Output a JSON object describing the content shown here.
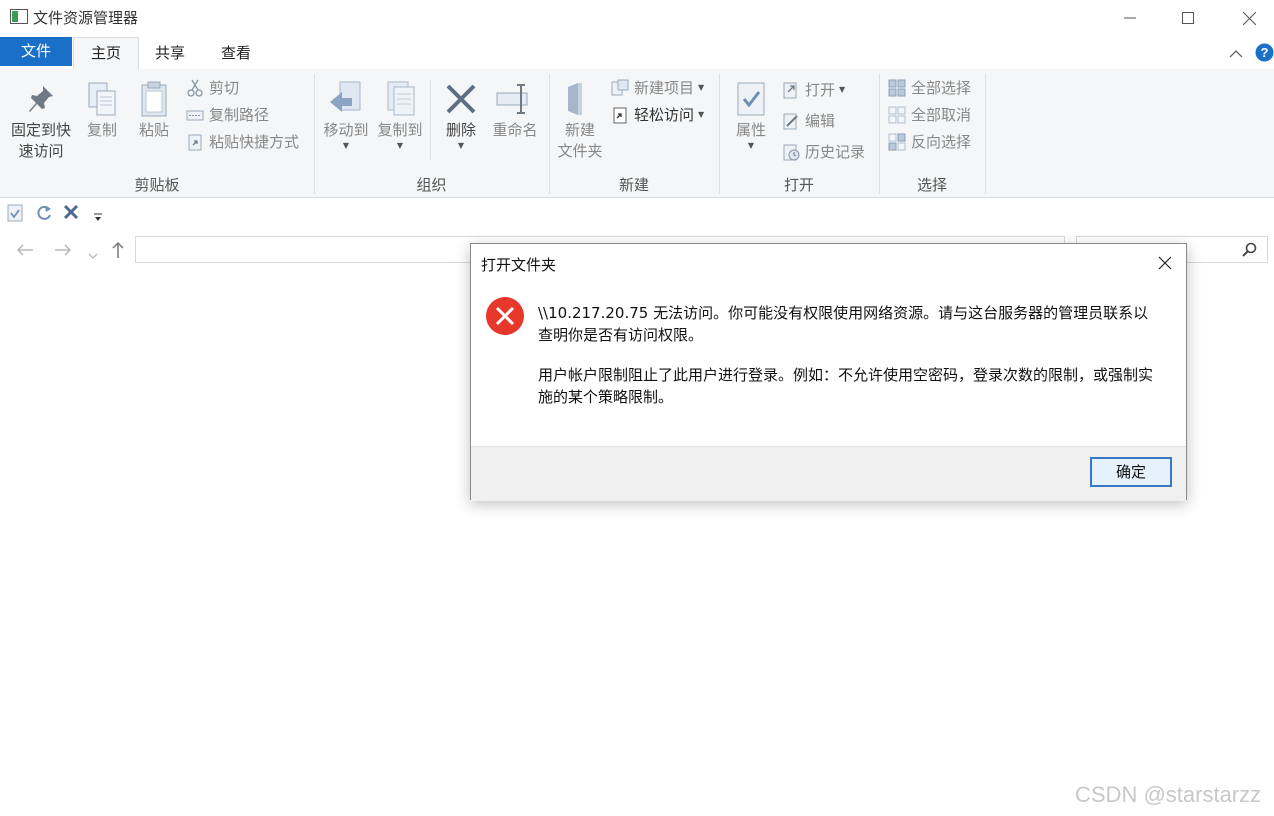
{
  "window": {
    "title": "文件资源管理器"
  },
  "tabs": [
    {
      "label": "文件"
    },
    {
      "label": "主页"
    },
    {
      "label": "共享"
    },
    {
      "label": "查看"
    }
  ],
  "ribbon": {
    "clipboard": {
      "label": "剪贴板",
      "pin": "固定到快速访问",
      "pin_line1": "固定到快",
      "pin_line2": "速访问",
      "copy": "复制",
      "paste": "粘贴",
      "cut": "剪切",
      "copy_path": "复制路径",
      "paste_shortcut": "粘贴快捷方式"
    },
    "organize": {
      "label": "组织",
      "move_to": "移动到",
      "copy_to": "复制到",
      "delete": "删除",
      "rename": "重命名"
    },
    "new": {
      "label": "新建",
      "new_folder_line1": "新建",
      "new_folder_line2": "文件夹",
      "new_item": "新建项目",
      "easy_access": "轻松访问"
    },
    "open": {
      "label": "打开",
      "properties": "属性",
      "open": "打开",
      "edit": "编辑",
      "history": "历史记录"
    },
    "select": {
      "label": "选择",
      "select_all": "全部选择",
      "select_none": "全部取消",
      "invert": "反向选择"
    }
  },
  "dialog": {
    "title": "打开文件夹",
    "message_line1": "\\\\10.217.20.75 无法访问。你可能没有权限使用网络资源。请与这台服务器的管理员联系以",
    "message_line2": "查明你是否有访问权限。",
    "detail_line1": "用户帐户限制阻止了此用户进行登录。例如：不允许使用空密码，登录次数的限制，或强制实",
    "detail_line2": "施的某个策略限制。",
    "ok": "确定"
  },
  "watermark": "CSDN @starstarzz",
  "colors": {
    "accent": "#1a6fc9",
    "error": "#e8372b"
  }
}
